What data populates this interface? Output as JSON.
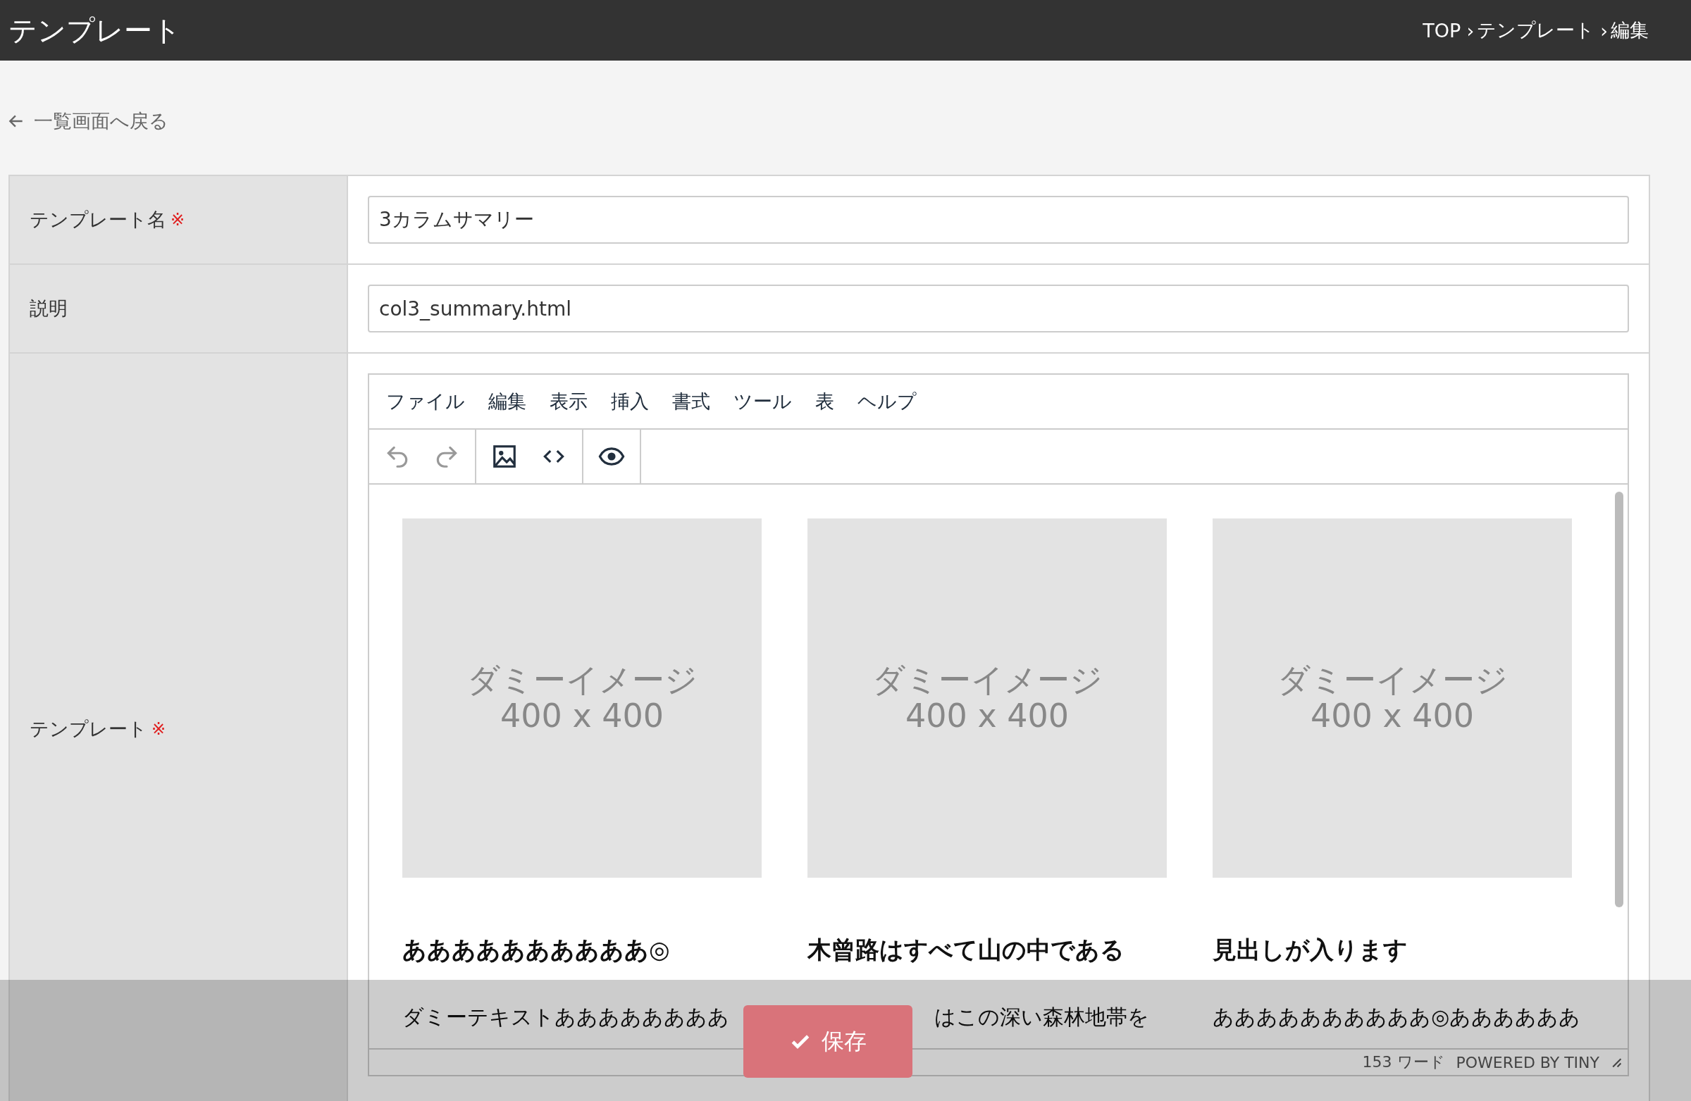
{
  "header": {
    "title": "テンプレート",
    "breadcrumb": [
      {
        "label": "TOP",
        "sep": "›"
      },
      {
        "label": "テンプレート",
        "sep": "›"
      },
      {
        "label": "編集"
      }
    ]
  },
  "back_link": {
    "label": "一覧画面へ戻る"
  },
  "fields": [
    {
      "kind": "input",
      "label": "テンプレート名",
      "required_mark": "※",
      "value": "3カラムサマリー"
    },
    {
      "kind": "input",
      "label": "説明",
      "value": "col3_summary.html"
    },
    {
      "kind": "editor",
      "label": "テンプレート",
      "required_mark": "※"
    }
  ],
  "editor": {
    "menu": [
      "ファイル",
      "編集",
      "表示",
      "挿入",
      "書式",
      "ツール",
      "表",
      "ヘルプ"
    ],
    "toolbar_groups": [
      [
        {
          "kind": "undo",
          "disabled": true
        },
        {
          "kind": "redo",
          "disabled": true
        }
      ],
      [
        {
          "kind": "image",
          "disabled": false
        },
        {
          "kind": "code",
          "disabled": false
        }
      ],
      [
        {
          "kind": "preview",
          "disabled": false
        }
      ]
    ],
    "columns": [
      {
        "image_text": [
          "ダミーイメージ",
          "400 x 400"
        ],
        "heading": "ああああああああああ◎",
        "body": "ダミーテキストああああああああ"
      },
      {
        "image_text": [
          "ダミーイメージ",
          "400 x 400"
        ],
        "heading": "木曾路はすべて山の中である",
        "body": "はこの深い森林地帯を"
      },
      {
        "image_text": [
          "ダミーイメージ",
          "400 x 400"
        ],
        "heading": "見出しが入ります",
        "body": "ああああああああああ◎ああああああ"
      }
    ],
    "word_count": "153 ワード",
    "branding": "POWERED BY TINY"
  },
  "save_button": {
    "label": "保存"
  }
}
